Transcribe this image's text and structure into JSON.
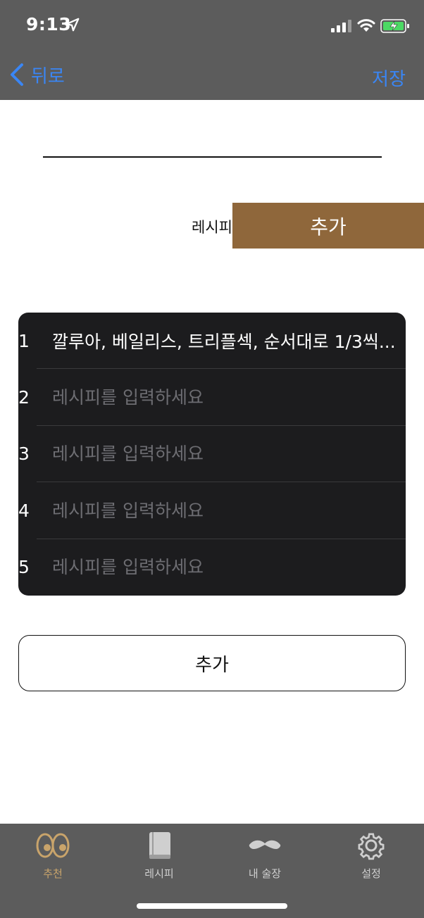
{
  "status_bar": {
    "time": "9:13",
    "icons": [
      "location-arrow-icon",
      "cellular-signal-icon",
      "wifi-icon",
      "battery-charging-icon"
    ]
  },
  "nav": {
    "back_label": "뒤로",
    "save_label": "저장",
    "accent_color": "#3a86f5"
  },
  "form": {
    "title_value": "",
    "recipe_label": "레시피",
    "add_top_label": "추가",
    "add_top_color": "#8f673b",
    "rows": [
      {
        "num": "1",
        "value": "깔루아, 베일리스, 트리플섹, 순서대로 1/3씩...",
        "placeholder": "레시피를 입력하세요"
      },
      {
        "num": "2",
        "value": "",
        "placeholder": "레시피를 입력하세요"
      },
      {
        "num": "3",
        "value": "",
        "placeholder": "레시피를 입력하세요"
      },
      {
        "num": "4",
        "value": "",
        "placeholder": "레시피를 입력하세요"
      },
      {
        "num": "5",
        "value": "",
        "placeholder": "레시피를 입력하세요"
      }
    ],
    "add_bottom_label": "추가"
  },
  "tabs": [
    {
      "label": "추천",
      "icon": "eyes-icon",
      "active": true
    },
    {
      "label": "레시피",
      "icon": "book-icon",
      "active": false
    },
    {
      "label": "내 술장",
      "icon": "mustache-icon",
      "active": false
    },
    {
      "label": "설정",
      "icon": "gear-icon",
      "active": false
    }
  ],
  "colors": {
    "bar_bg": "#5c5c5c",
    "table_bg": "#1c1c1e",
    "active_tab": "#c9a46b"
  }
}
